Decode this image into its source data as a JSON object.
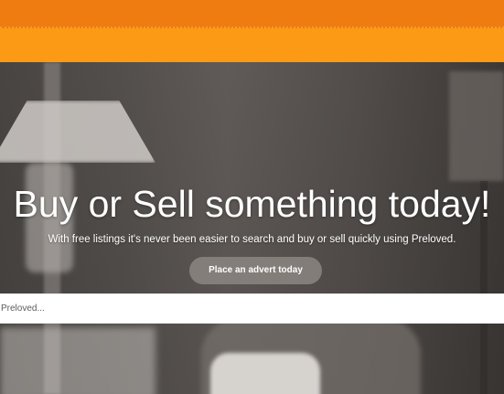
{
  "hero": {
    "title": "Buy or Sell something today!",
    "subtitle": "With free listings it's never been easier to search and buy or sell quickly using Preloved.",
    "cta_label": "Place an advert today"
  },
  "search": {
    "placeholder": "Preloved..."
  },
  "colors": {
    "top_bar": "#ef7c10",
    "nav_bar": "#fd9a15",
    "cta_background": "#8c8681"
  }
}
